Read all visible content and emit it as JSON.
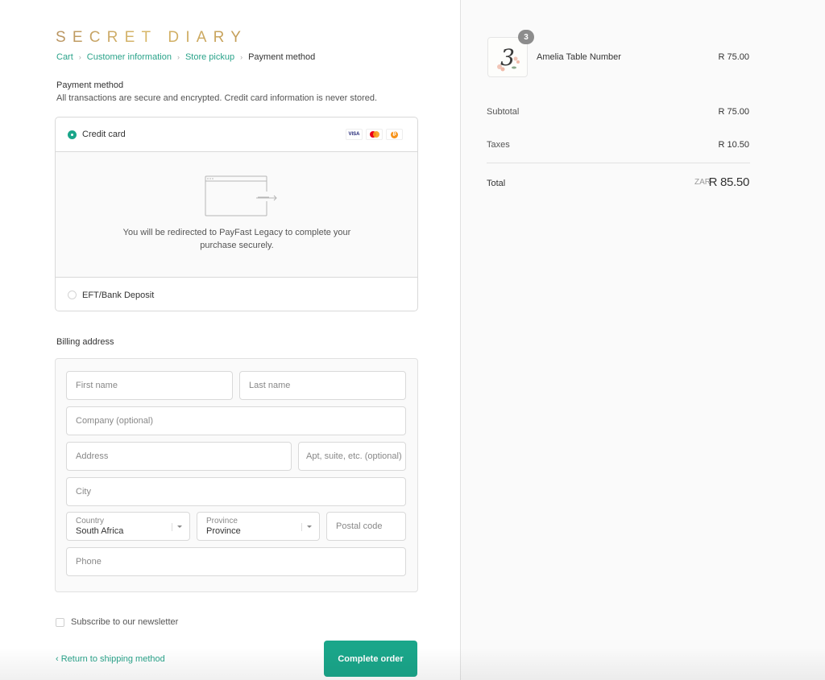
{
  "brand": {
    "name": "SECRET DIARY"
  },
  "breadcrumb": [
    {
      "label": "Cart",
      "link": true
    },
    {
      "label": "Customer information",
      "link": true
    },
    {
      "label": "Store pickup",
      "link": true
    },
    {
      "label": "Payment method",
      "link": false
    }
  ],
  "breadcrumb_separator": "›",
  "payment": {
    "title": "Payment method",
    "subtitle": "All transactions are secure and encrypted. Credit card information is never stored.",
    "options": [
      {
        "label": "Credit card",
        "selected": true,
        "card_icons": [
          "visa-icon",
          "mastercard-icon",
          "bitcoin-icon"
        ]
      },
      {
        "label": "EFT/Bank Deposit",
        "selected": false
      }
    ],
    "card_visa_text": "VISA",
    "card_btc_text": "₿",
    "redirect_message": "You will be redirected to PayFast Legacy to complete your purchase securely."
  },
  "billing": {
    "title": "Billing address",
    "fields": {
      "first_name": {
        "placeholder": "First name",
        "value": ""
      },
      "last_name": {
        "placeholder": "Last name",
        "value": ""
      },
      "company": {
        "placeholder": "Company (optional)",
        "value": ""
      },
      "address": {
        "placeholder": "Address",
        "value": ""
      },
      "apt": {
        "placeholder": "Apt, suite, etc. (optional)",
        "value": ""
      },
      "city": {
        "placeholder": "City",
        "value": ""
      },
      "country": {
        "label": "Country",
        "value": "South Africa"
      },
      "province": {
        "label": "Province",
        "value": "Province"
      },
      "postal_code": {
        "placeholder": "Postal code",
        "value": ""
      },
      "phone": {
        "placeholder": "Phone",
        "value": ""
      }
    }
  },
  "newsletter": {
    "label": "Subscribe to our newsletter",
    "checked": false
  },
  "footer": {
    "return_link": "‹ Return to shipping method",
    "complete_button": "Complete order"
  },
  "order_summary": {
    "items": [
      {
        "name": "Amelia Table Number",
        "quantity": "3",
        "price": "R 75.00",
        "thumbnail_glyph": "3"
      }
    ],
    "subtotal_label": "Subtotal",
    "subtotal": "R 75.00",
    "taxes_label": "Taxes",
    "taxes": "R 10.50",
    "total_label": "Total",
    "currency": "ZAR",
    "total": "R 85.50"
  },
  "colors": {
    "accent": "#1aa68a",
    "link": "#2aa38a",
    "brand_gold": "#c9a44f",
    "sidebar_bg": "#fafafa"
  }
}
